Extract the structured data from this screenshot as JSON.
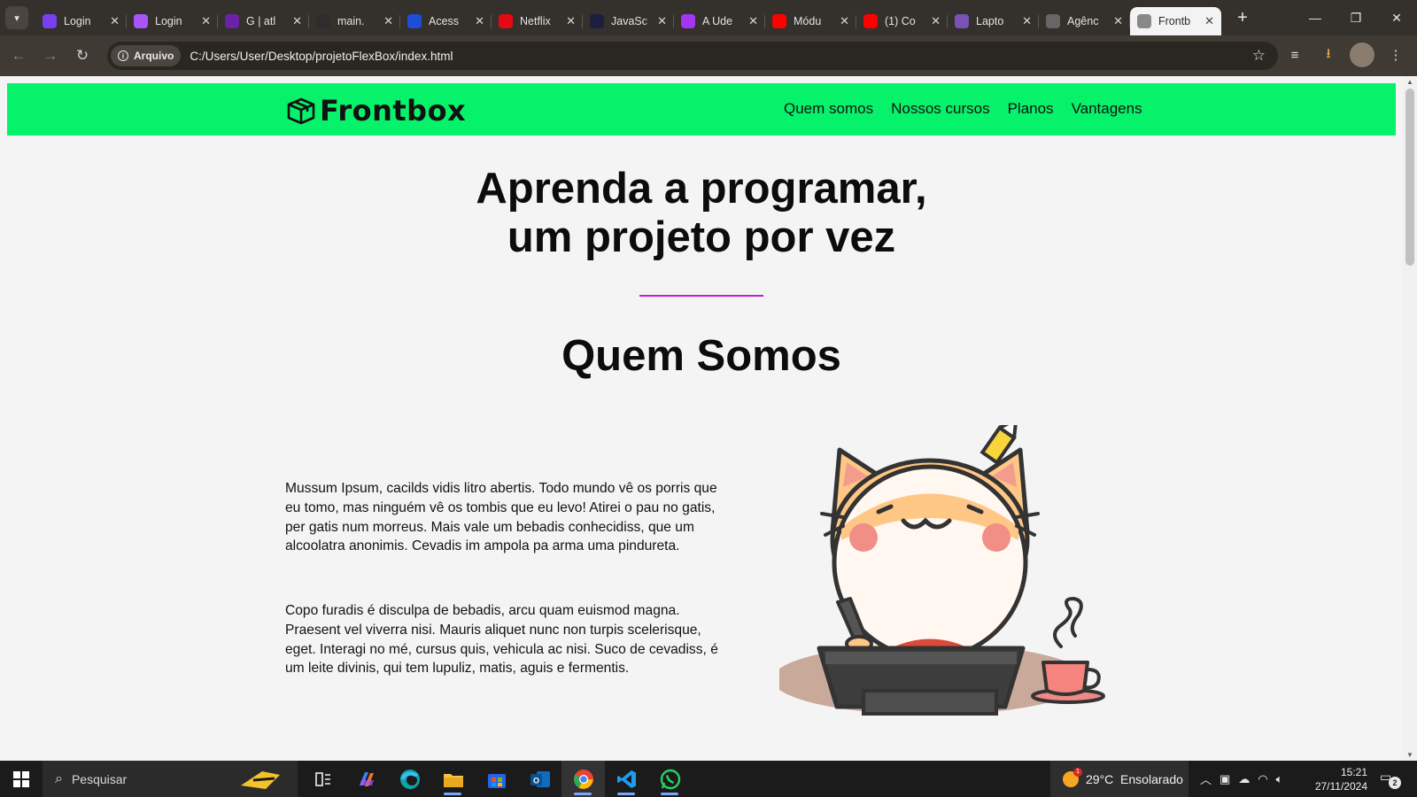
{
  "browser": {
    "tabs": [
      {
        "title": "Login",
        "icon": "purple-app-icon",
        "color": "#7b3ff2"
      },
      {
        "title": "Login",
        "icon": "angle-brackets-icon",
        "color": "#a855f7"
      },
      {
        "title": "G | atl",
        "icon": "atlas-icon",
        "color": "#6b21a8"
      },
      {
        "title": "main.",
        "icon": "github-icon",
        "color": "#2d2d2d"
      },
      {
        "title": "Acess",
        "icon": "star-icon",
        "color": "#1d4ed8"
      },
      {
        "title": "Netflix",
        "icon": "netflix-icon",
        "color": "#e50914"
      },
      {
        "title": "JavaSc",
        "icon": "javascript-icon",
        "color": "#1e1e3f"
      },
      {
        "title": "A Ude",
        "icon": "udemy-icon",
        "color": "#a435f0"
      },
      {
        "title": "Módu",
        "icon": "youtube-icon",
        "color": "#ff0000"
      },
      {
        "title": "(1) Co",
        "icon": "youtube-icon",
        "color": "#ff0000"
      },
      {
        "title": "Lapto",
        "icon": "bootstrap-icon",
        "color": "#7952b3"
      },
      {
        "title": "Agênc",
        "icon": "globe-icon",
        "color": "#666"
      },
      {
        "title": "Frontb",
        "icon": "globe-icon",
        "color": "#888",
        "active": true
      }
    ],
    "address": {
      "chip_label": "Arquivo",
      "url": "C:/Users/User/Desktop/projetoFlexBox/index.html"
    }
  },
  "site": {
    "brand": "Frontbox",
    "nav": [
      "Quem somos",
      "Nossos cursos",
      "Planos",
      "Vantagens"
    ],
    "hero": {
      "line1": "Aprenda a programar,",
      "line2": "um projeto por vez"
    },
    "section_title": "Quem Somos",
    "paragraphs": [
      "Mussum Ipsum, cacilds vidis litro abertis. Todo mundo vê os porris que eu tomo, mas ninguém vê os tombis que eu levo! Atirei o pau no gatis, per gatis num morreus. Mais vale um bebadis conhecidiss, que um alcoolatra anonimis. Cevadis im ampola pa arma uma pindureta.",
      "Copo furadis é disculpa de bebadis, arcu quam euismod magna. Praesent vel viverra nisi. Mauris aliquet nunc non turpis scelerisque, eget. Interagi no mé, cursus quis, vehicula ac nisi. Suco de cevadiss, é um leite divinis, qui tem lupuliz, matis, aguis e fermentis."
    ],
    "colors": {
      "header": "#07f26b",
      "divider": "#c51bd6"
    }
  },
  "taskbar": {
    "search_placeholder": "Pesquisar",
    "weather": "29°C  Ensolarado",
    "weather_badge": "1",
    "time": "15:21",
    "date": "27/11/2024",
    "notifications": "2"
  }
}
